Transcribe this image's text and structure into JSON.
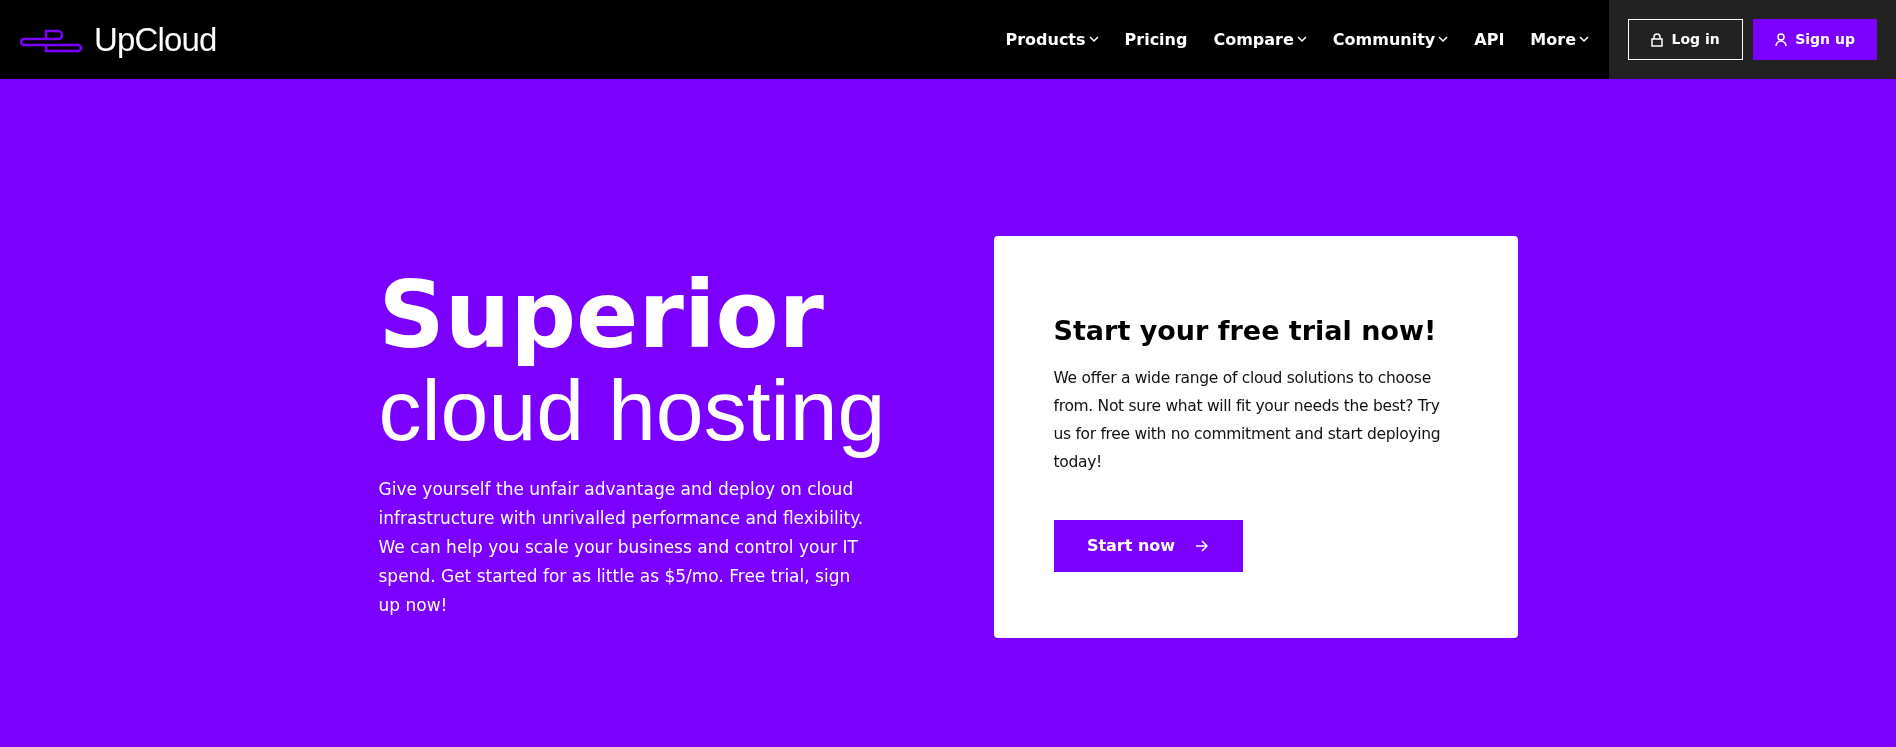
{
  "header": {
    "logo": "UpCloud",
    "nav": [
      {
        "label": "Products",
        "dropdown": true
      },
      {
        "label": "Pricing",
        "dropdown": false
      },
      {
        "label": "Compare",
        "dropdown": true
      },
      {
        "label": "Community",
        "dropdown": true
      },
      {
        "label": "API",
        "dropdown": false
      },
      {
        "label": "More",
        "dropdown": true
      }
    ],
    "login": "Log in",
    "signup": "Sign up"
  },
  "hero": {
    "title_bold": "Superior",
    "title_light": "cloud hosting",
    "text": "Give yourself the unfair advantage and deploy on cloud infrastructure with unrivalled performance and flexibility. We can help you scale your business and control your IT spend. Get started for as little as $5/mo. Free trial, sign up now!"
  },
  "card": {
    "title": "Start your free trial now!",
    "text": "We offer a wide range of cloud solutions to choose from. Not sure what will fit your needs the best? Try us for free with no commitment and start deploying today!",
    "button": "Start now"
  }
}
